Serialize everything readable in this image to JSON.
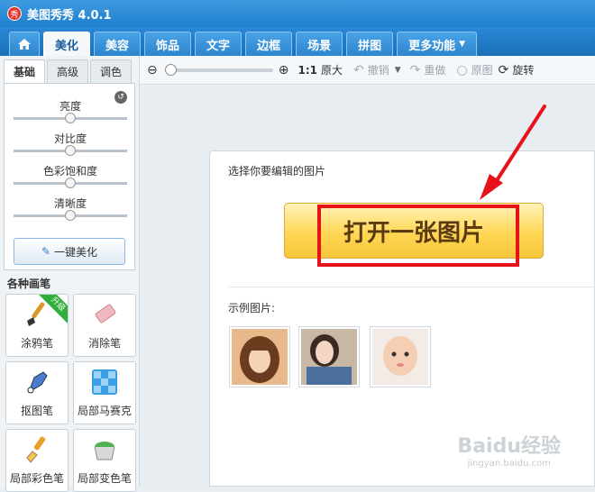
{
  "app": {
    "logo_text": "秀",
    "title": "美图秀秀 4.0.1"
  },
  "tabs": {
    "home_icon": "home-icon",
    "items": [
      {
        "label": "美化",
        "active": true
      },
      {
        "label": "美容"
      },
      {
        "label": "饰品"
      },
      {
        "label": "文字"
      },
      {
        "label": "边框"
      },
      {
        "label": "场景"
      },
      {
        "label": "拼图"
      },
      {
        "label": "更多功能"
      }
    ]
  },
  "toolbar": {
    "zoom_label": "1:1",
    "original_size": "原大",
    "undo": "撤销",
    "redo": "重做",
    "original": "原图",
    "rotate": "旋转"
  },
  "left": {
    "subtabs": [
      "基础",
      "高级",
      "调色"
    ],
    "adjustments": [
      "亮度",
      "对比度",
      "色彩饱和度",
      "清晰度"
    ],
    "onekey": "一键美化",
    "pens_title": "各种画笔",
    "pens": [
      {
        "label": "涂鸦笔",
        "badge": "升级"
      },
      {
        "label": "消除笔"
      },
      {
        "label": "抠图笔"
      },
      {
        "label": "局部马赛克"
      },
      {
        "label": "局部彩色笔"
      },
      {
        "label": "局部变色笔"
      }
    ]
  },
  "main": {
    "choose_label": "选择你要编辑的图片",
    "open_button": "打开一张图片",
    "examples_label": "示例图片:"
  },
  "watermark": {
    "main": "Baidu经验",
    "sub": "jingyan.baidu.com"
  },
  "colors": {
    "titlebar": "#1f7fcf",
    "highlight": "#e8121a",
    "button": "#ffd755"
  }
}
